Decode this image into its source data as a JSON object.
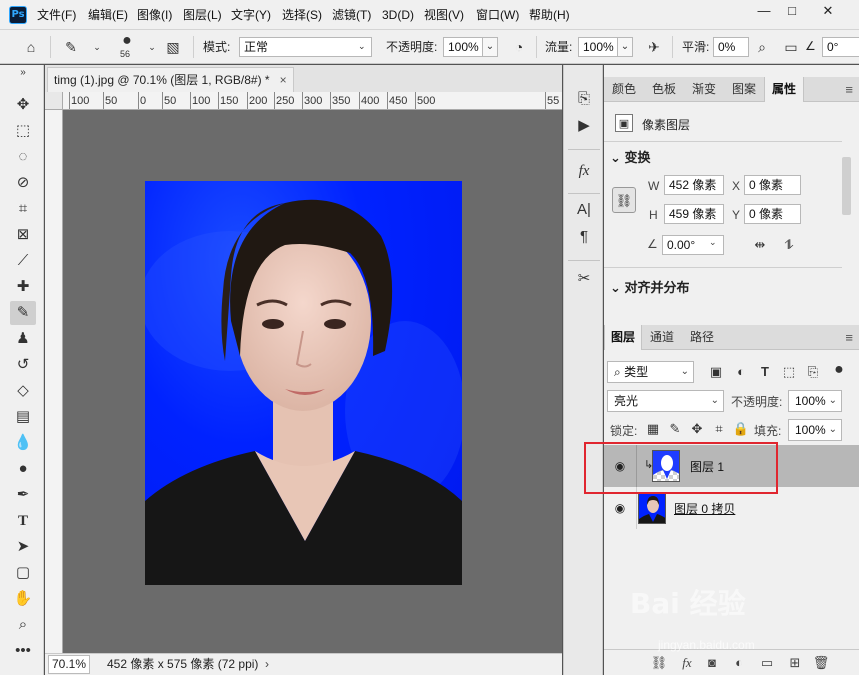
{
  "app": {
    "logo": "Ps"
  },
  "menu": [
    "文件(F)",
    "编辑(E)",
    "图像(I)",
    "图层(L)",
    "文字(Y)",
    "选择(S)",
    "滤镜(T)",
    "3D(D)",
    "视图(V)",
    "窗口(W)",
    "帮助(H)"
  ],
  "window_controls": [
    "—",
    "□",
    "✕"
  ],
  "options": {
    "brush_size": "56",
    "mode_label": "模式:",
    "mode_value": "正常",
    "opacity_label": "不透明度:",
    "opacity_value": "100%",
    "flow_label": "流量:",
    "flow_value": "100%",
    "smooth_label": "平滑:",
    "smooth_value": "0%",
    "angle_value": "0°"
  },
  "document": {
    "tab_title": "timg (1).jpg @ 70.1% (图层 1, RGB/8#) *",
    "close": "×",
    "ruler_labels": [
      "100",
      "50",
      "0",
      "50",
      "100",
      "150",
      "200",
      "250",
      "300",
      "350",
      "400",
      "450",
      "500",
      "55"
    ],
    "zoom": "70.1%",
    "info": "452 像素 x 575 像素 (72 ppi)",
    "info_arrow": "›"
  },
  "properties": {
    "tabs": [
      "颜色",
      "色板",
      "渐变",
      "图案",
      "属性"
    ],
    "active_tab": "属性",
    "layer_type": "像素图层",
    "transform_title": "变换",
    "w_label": "W",
    "w_value": "452 像素",
    "x_label": "X",
    "x_value": "0 像素",
    "h_label": "H",
    "h_value": "459 像素",
    "y_label": "Y",
    "y_value": "0 像素",
    "angle_value": "0.00°",
    "align_title": "对齐并分布"
  },
  "layers": {
    "tabs": [
      "图层",
      "通道",
      "路径"
    ],
    "filter_label": "类型",
    "blend_mode": "亮光",
    "opacity_label": "不透明度:",
    "opacity_value": "100%",
    "lock_label": "锁定:",
    "fill_label": "填充:",
    "fill_value": "100%",
    "items": [
      {
        "name": "图层 1",
        "selected": true
      },
      {
        "name": "图层 0 拷贝",
        "selected": false
      }
    ]
  },
  "watermark": {
    "brand": "Bai  经验",
    "url": "jingyan.baidu.com"
  },
  "colors": {
    "accent": "#31a8ff",
    "photo_bg": "#0022ff",
    "highlight": "#e0262f"
  }
}
